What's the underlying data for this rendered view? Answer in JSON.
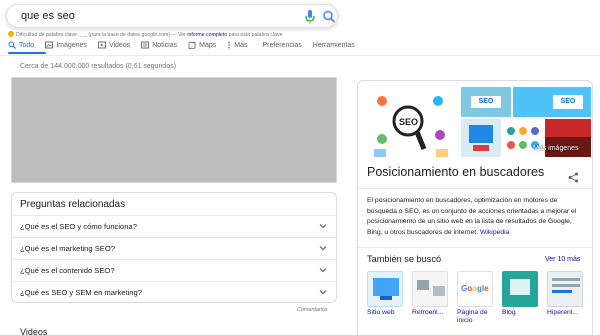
{
  "search": {
    "query": "que es seo"
  },
  "extension_note": {
    "prefix": "Dificultad de palabra clave: _ _ (para la base de datos google.com) — Ver",
    "link": "informe completo",
    "suffix": "para esta palabra clave"
  },
  "tabs": [
    {
      "label": "Todo",
      "icon": "search-icon",
      "active": true
    },
    {
      "label": "Imágenes",
      "icon": "image-icon"
    },
    {
      "label": "Videos",
      "icon": "video-icon"
    },
    {
      "label": "Noticias",
      "icon": "news-icon"
    },
    {
      "label": "Maps",
      "icon": "map-icon"
    },
    {
      "label": "Más",
      "icon": "more-dots-icon"
    },
    {
      "label": "Preferencias"
    },
    {
      "label": "Herramientas"
    }
  ],
  "results_count": "Cerca de 144.000.000 resultados (0,61 segundos)",
  "paa": {
    "title": "Preguntas relacionadas",
    "questions": [
      "¿Qué es el SEO y cómo funciona?",
      "¿Qué es el marketing SEO?",
      "¿Qué es el contenido SEO?",
      "¿Qué es SEO y SEM en marketing?"
    ],
    "comments": "Comentarios"
  },
  "videos_heading": "Videos",
  "knowledge_panel": {
    "more_images": "Más imágenes",
    "title": "Posicionamiento en buscadores",
    "description": "El posicionamiento en buscadores, optimización en motores de búsqueda o SEO, es un conjunto de acciones orientadas a mejorar el posicionamiento de un sitio web en la lista de resultados de Google, Bing, u otros buscadores de internet.",
    "source": "Wikipedia",
    "also_searched": "También se buscó",
    "see_more": "Ver 10 más",
    "related": [
      "Sitio web",
      "Retroenl...",
      "Página de inicio",
      "Blog",
      "Hiperenl..."
    ]
  },
  "colors": {
    "accent": "#1a73e8",
    "link": "#1a0dab",
    "muted": "#70757a"
  }
}
